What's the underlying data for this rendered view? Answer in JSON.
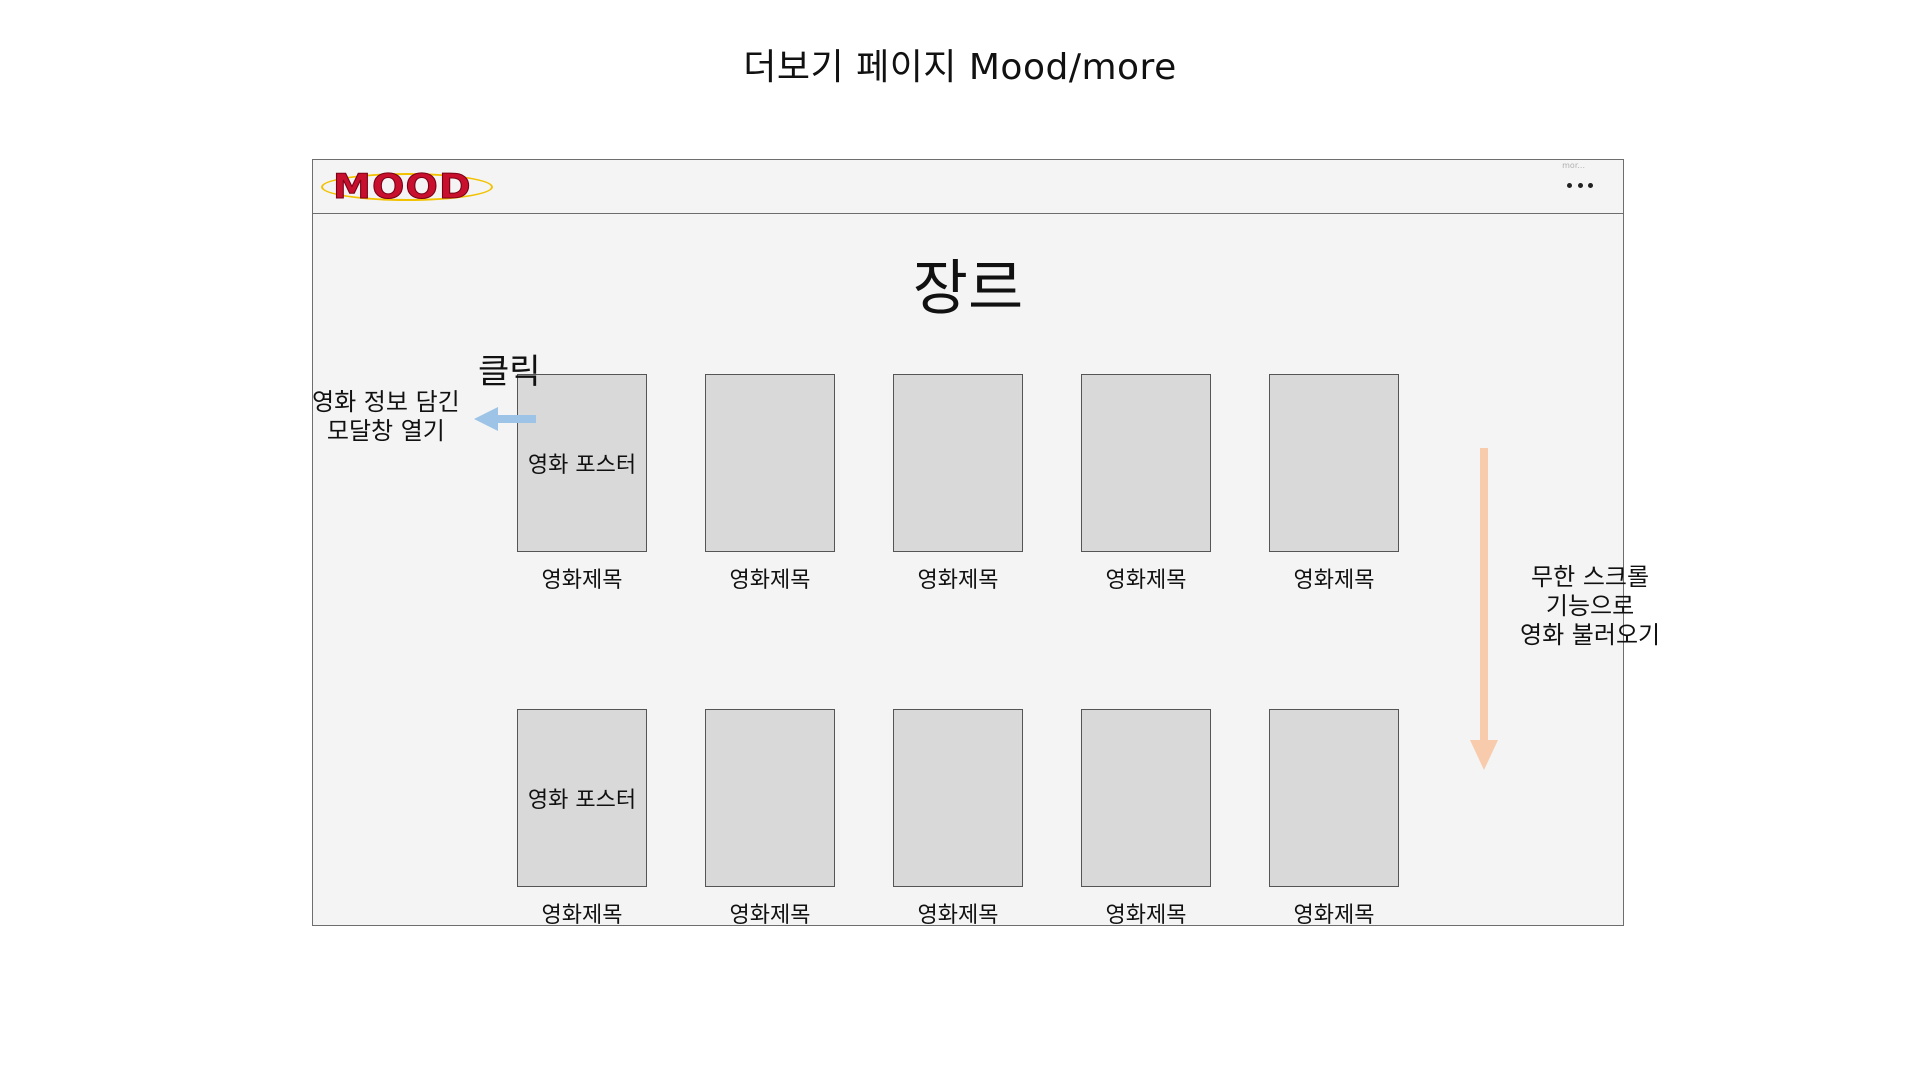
{
  "page": {
    "title": "더보기 페이지 Mood/more"
  },
  "header": {
    "logo_text": "MOOD",
    "more_caption": "mor...",
    "more_icon": "more-dots-icon"
  },
  "main": {
    "genre_title": "장르",
    "rows": [
      [
        {
          "poster_label": "영화 포스터",
          "title": "영화제목"
        },
        {
          "poster_label": "",
          "title": "영화제목"
        },
        {
          "poster_label": "",
          "title": "영화제목"
        },
        {
          "poster_label": "",
          "title": "영화제목"
        },
        {
          "poster_label": "",
          "title": "영화제목"
        }
      ],
      [
        {
          "poster_label": "영화 포스터",
          "title": "영화제목"
        },
        {
          "poster_label": "",
          "title": "영화제목"
        },
        {
          "poster_label": "",
          "title": "영화제목"
        },
        {
          "poster_label": "",
          "title": "영화제목"
        },
        {
          "poster_label": "",
          "title": "영화제목"
        }
      ]
    ]
  },
  "annotations": {
    "click": "클릭",
    "modal_line1": "영화 정보 담긴",
    "modal_line2": "모달창 열기",
    "scroll_line1": "무한 스크롤",
    "scroll_line2": "기능으로",
    "scroll_line3": "영화 불러오기"
  },
  "colors": {
    "frame_bg": "#f4f4f4",
    "poster_bg": "#d9d9d9",
    "logo_red": "#c8102e",
    "logo_ring": "#f2c200",
    "click_arrow": "#9dc3e6",
    "scroll_arrow": "#f8cbad"
  }
}
